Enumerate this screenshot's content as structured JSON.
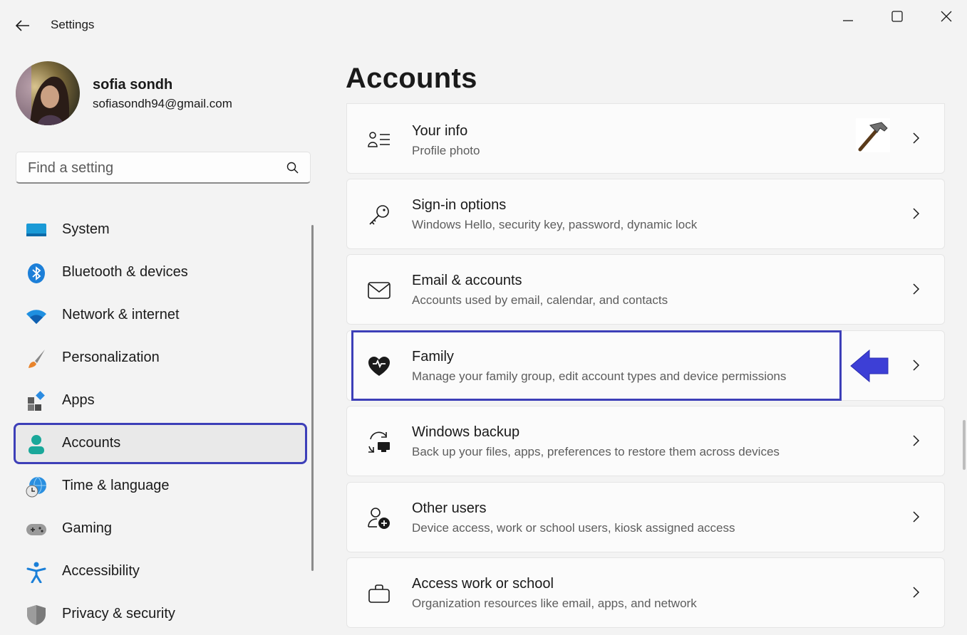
{
  "window": {
    "title": "Settings",
    "controls": [
      "minimize",
      "maximize",
      "close"
    ]
  },
  "profile": {
    "name": "sofia sondh",
    "email": "sofiasondh94@gmail.com"
  },
  "search": {
    "placeholder": "Find a setting",
    "value": ""
  },
  "sidebar": {
    "items": [
      {
        "label": "System",
        "icon": "system-icon"
      },
      {
        "label": "Bluetooth & devices",
        "icon": "bluetooth-icon"
      },
      {
        "label": "Network & internet",
        "icon": "wifi-icon"
      },
      {
        "label": "Personalization",
        "icon": "brush-icon"
      },
      {
        "label": "Apps",
        "icon": "apps-icon"
      },
      {
        "label": "Accounts",
        "icon": "person-icon",
        "selected": true
      },
      {
        "label": "Time & language",
        "icon": "globe-clock-icon"
      },
      {
        "label": "Gaming",
        "icon": "gamepad-icon"
      },
      {
        "label": "Accessibility",
        "icon": "accessibility-icon"
      },
      {
        "label": "Privacy & security",
        "icon": "shield-icon"
      }
    ]
  },
  "main": {
    "title": "Accounts",
    "cards": [
      {
        "title": "Your info",
        "subtitle": "Profile photo",
        "icon": "user-info-icon"
      },
      {
        "title": "Sign-in options",
        "subtitle": "Windows Hello, security key, password, dynamic lock",
        "icon": "key-icon"
      },
      {
        "title": "Email & accounts",
        "subtitle": "Accounts used by email, calendar, and contacts",
        "icon": "mail-icon"
      },
      {
        "title": "Family",
        "subtitle": "Manage your family group, edit account types and device permissions",
        "icon": "family-heart-icon",
        "highlighted": true
      },
      {
        "title": "Windows backup",
        "subtitle": "Back up your files, apps, preferences to restore them across devices",
        "icon": "backup-icon"
      },
      {
        "title": "Other users",
        "subtitle": "Device access, work or school users, kiosk assigned access",
        "icon": "add-user-icon"
      },
      {
        "title": "Access work or school",
        "subtitle": "Organization resources like email, apps, and network",
        "icon": "briefcase-icon"
      }
    ]
  },
  "colors": {
    "accent": "#3d3fb8",
    "background": "#f3f3f3",
    "card": "#fbfbfb",
    "secondary_text": "#5d5d5d"
  }
}
